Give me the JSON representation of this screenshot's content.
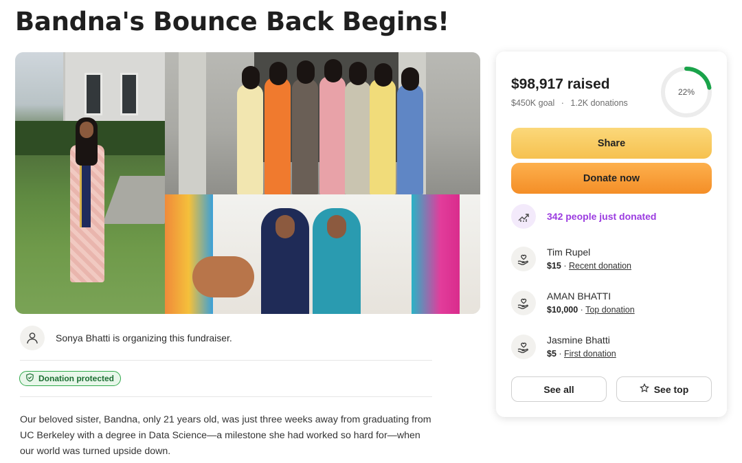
{
  "page": {
    "title": "Bandna's Bounce Back Begins!"
  },
  "organizer": {
    "text": "Sonya Bhatti is organizing this fundraiser."
  },
  "badge": {
    "label": "Donation protected"
  },
  "story": {
    "text": "Our beloved sister, Bandna, only 21 years old, was just three weeks away from graduating from UC Berkeley with a degree in Data Science—a milestone she had worked so hard for—when our world was turned upside down."
  },
  "card": {
    "raised": "$98,917 raised",
    "goal": "$450K goal",
    "donations": "1.2K donations",
    "percent_label": "22%",
    "progress_fraction": 0.22,
    "progress_color": "#1aa34a",
    "share_label": "Share",
    "donate_label": "Donate now",
    "trend_text": "342 people just donated",
    "donors": [
      {
        "name": "Tim Rupel",
        "amount": "$15",
        "tag": "Recent donation"
      },
      {
        "name": "AMAN BHATTI",
        "amount": "$10,000",
        "tag": "Top donation"
      },
      {
        "name": "Jasmine Bhatti",
        "amount": "$5",
        "tag": "First donation"
      }
    ],
    "see_all_label": "See all",
    "see_top_label": "See top"
  },
  "icons": {
    "organizer": "person-icon",
    "badge": "shield-icon",
    "trend": "trending-up-icon",
    "donor": "heart-hand-icon",
    "see_top": "star-icon"
  },
  "colors": {
    "accent_purple": "#9b3be0",
    "share": "#f6c14f",
    "donate": "#f48e27",
    "protected": "#2fa84a"
  }
}
